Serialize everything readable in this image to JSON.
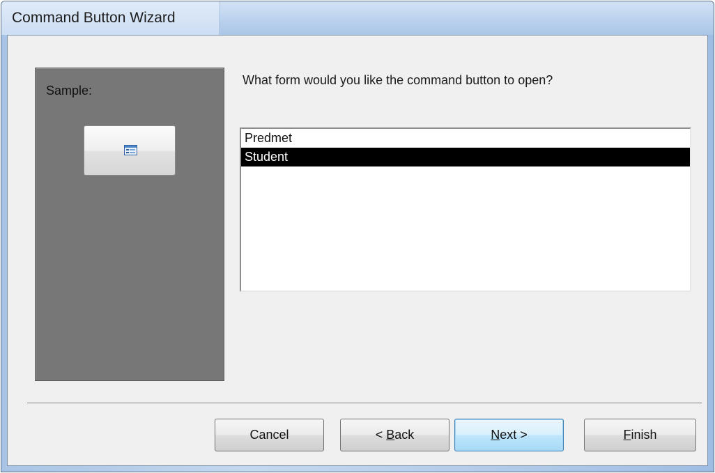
{
  "window": {
    "title": "Command Button Wizard"
  },
  "sample": {
    "label": "Sample:",
    "button_icon": "form-icon"
  },
  "question": "What form would you like the command button to open?",
  "forms": [
    {
      "name": "Predmet",
      "selected": false
    },
    {
      "name": "Student",
      "selected": true
    }
  ],
  "buttons": {
    "cancel": {
      "label": "Cancel"
    },
    "back": {
      "prefix": "< ",
      "mnemonic": "B",
      "rest": "ack"
    },
    "next": {
      "prefix": "",
      "mnemonic": "N",
      "rest": "ext >"
    },
    "finish": {
      "prefix": "",
      "mnemonic": "F",
      "rest": "inish"
    }
  },
  "colors": {
    "selection_bg": "#000000",
    "selection_fg": "#ffffff",
    "sample_panel": "#777777",
    "default_button_border": "#3c7fb1"
  }
}
